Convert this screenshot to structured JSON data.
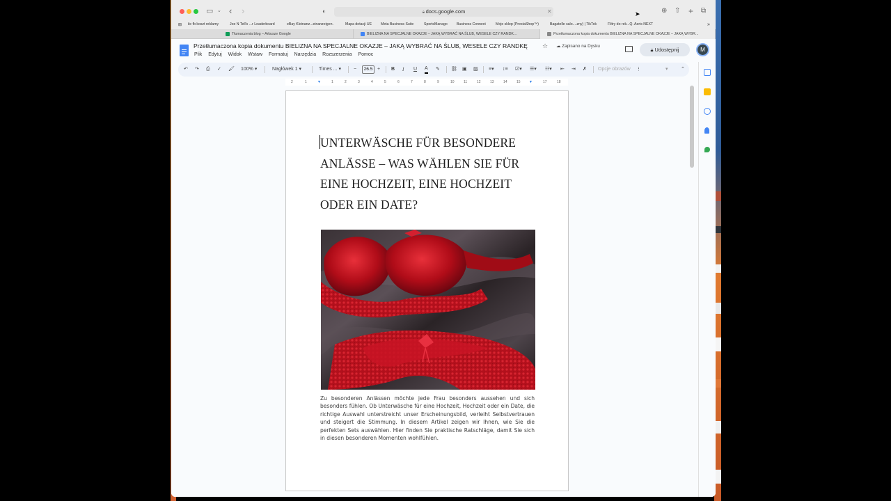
{
  "browser": {
    "url": "docs.google.com",
    "bookmarks": [
      "ile fb koszt reklamy",
      "Joe N Tell's ...r Leaderboard",
      "eBay Kleinanz...einanzeigen.",
      "Mapa dotacji UE",
      "Meta Business Suite",
      "SportsManago",
      "Business Connect",
      "Moje sklep (PrestaShop™)",
      "Bagatelle salo....zny) | TikTok",
      "Filtry do rek...Q. Aeris NEXT"
    ],
    "tabs": [
      "Tłumaczenia blog – Arkusze Google",
      "BIELIZNA NA SPECJALNE OKAZJE – JAKĄ WYBRAĆ NA ŚLUB, WESELE CZY RANDK...",
      "Przetłumaczona kopia dokumentu BIELIZNA NA SPECJALNE OKAZJE – JAKĄ WYBR..."
    ]
  },
  "docs": {
    "title": "Przetłumaczona kopia dokumentu BIELIZNA NA SPECJALNE OKAZJE – JAKĄ WYBRAĆ NA ŚLUB, WESELE CZY RANDKĘ",
    "saved_status": "Zapisano na Dysku",
    "share_label": "Udostępnij",
    "avatar_initial": "M",
    "menu": [
      "Plik",
      "Edytuj",
      "Widok",
      "Wstaw",
      "Formatuj",
      "Narzędzia",
      "Rozszerzenia",
      "Pomoc"
    ]
  },
  "toolbar": {
    "zoom": "100%",
    "style": "Nagłówek 1",
    "font": "Times ...",
    "font_size": "26.5",
    "image_options": "Opcje obrazów"
  },
  "ruler": [
    "2",
    "1",
    "1",
    "2",
    "3",
    "4",
    "5",
    "6",
    "7",
    "8",
    "9",
    "10",
    "11",
    "12",
    "13",
    "14",
    "15",
    "16",
    "17",
    "18"
  ],
  "document": {
    "heading": "UNTERWÄSCHE FÜR BESONDERE ANLÄSSE – WAS WÄHLEN SIE FÜR EINE HOCHZEIT, EINE HOCHZEIT ODER EIN DATE?",
    "body": "Zu besonderen Anlässen möchte jede Frau besonders aussehen und sich besonders fühlen. Ob Unterwäsche für eine Hochzeit, Hochzeit oder ein Date, die richtige Auswahl unterstreicht unser Erscheinungsbild, verleiht Selbstvertrauen und steigert die Stimmung. In diesem Artikel zeigen wir Ihnen, wie Sie die perfekten Sets auswählen. Hier finden Sie praktische Ratschläge, damit Sie sich in diesen besonderen Momenten wohlfühlen."
  },
  "colors": {
    "docs_blue": "#4285f4",
    "sheets_green": "#0f9d58",
    "lingerie_red": "#c8101c",
    "satin_dark": "#2c2528"
  }
}
